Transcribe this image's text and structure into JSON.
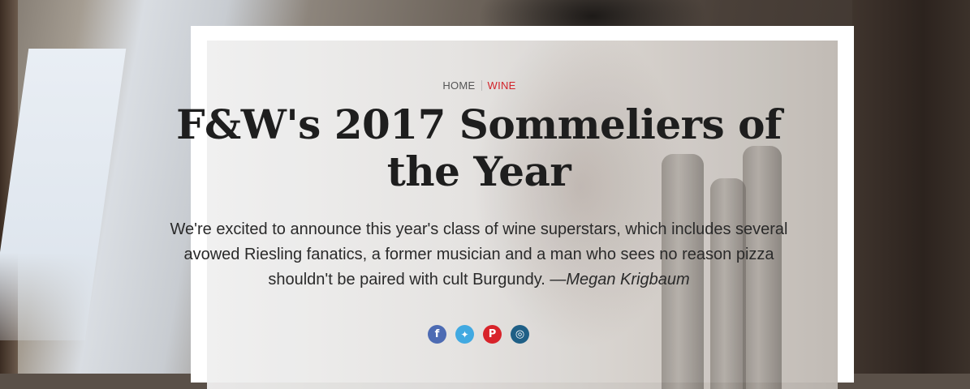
{
  "breadcrumb": {
    "home": "HOME",
    "section": "WINE"
  },
  "article": {
    "title": "F&W's 2017 Sommeliers of the Year",
    "dek": "We're excited to announce this year's class of wine superstars, which includes several avowed Riesling fanatics, a former musician and a man who sees no reason pizza shouldn't be paired with cult Burgundy.",
    "byline": "—Megan Krigbaum"
  },
  "social": [
    {
      "icon": "facebook-icon",
      "glyph": "f",
      "color": "#4d6bb3"
    },
    {
      "icon": "twitter-icon",
      "glyph": "🐦",
      "color": "#41a9e1"
    },
    {
      "icon": "pinterest-icon",
      "glyph": "P",
      "color": "#d8232a"
    },
    {
      "icon": "instagram-icon",
      "glyph": "◎",
      "color": "#1f5f86"
    }
  ],
  "colors": {
    "accent": "#d2232a",
    "title": "#1e1e1e",
    "text": "#2a2a2a"
  }
}
